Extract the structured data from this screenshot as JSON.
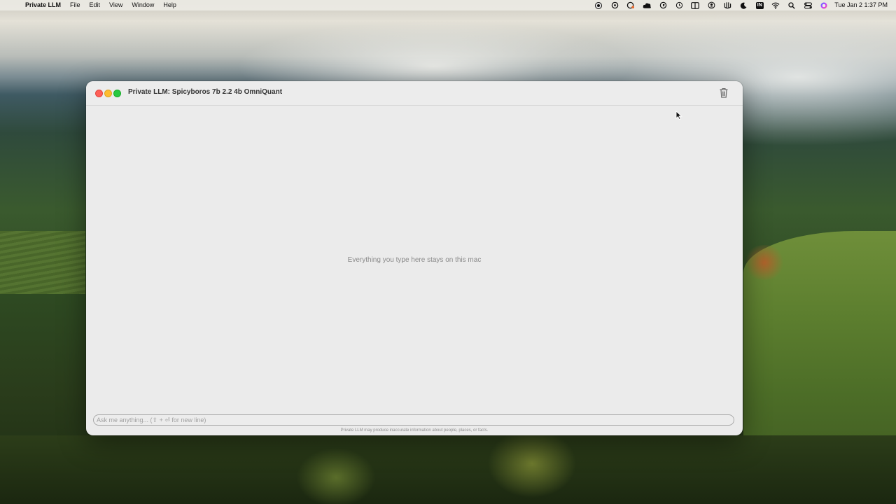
{
  "menubar": {
    "app_name": "Private LLM",
    "items": [
      "File",
      "Edit",
      "View",
      "Window",
      "Help"
    ],
    "status_icons": [
      "screen-record-icon",
      "chatgpt-icon",
      "copilot-icon",
      "cloud-app-icon",
      "grammarly-icon",
      "time-machine-icon",
      "sidebar-icon",
      "user-icon",
      "hand-icon",
      "moon-icon",
      "input-source-icon",
      "wifi-icon",
      "search-icon",
      "control-center-icon",
      "siri-icon"
    ],
    "input_source": "IN",
    "clock": "Tue Jan 2  1:37 PM"
  },
  "window": {
    "title": "Private LLM: Spicyboros 7b 2.2 4b OmniQuant",
    "empty_message": "Everything you type here stays on this mac",
    "input_placeholder": "Ask me anything... (⇧ + ⏎ for new line)",
    "disclaimer": "Private LLM may produce inaccurate information about people, places, or facts."
  },
  "colors": {
    "close": "#fe5f57",
    "minimize": "#febc2e",
    "maximize": "#28c840",
    "window_bg": "#ebebeb"
  }
}
